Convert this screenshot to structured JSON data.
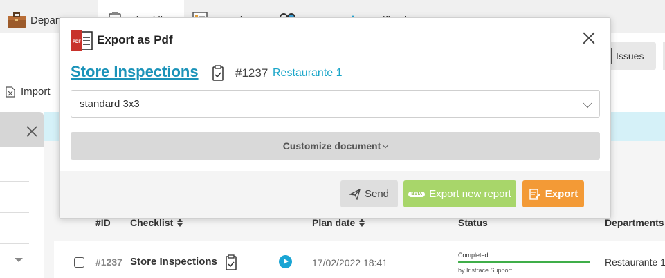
{
  "topnav": {
    "items": [
      {
        "label": "Departments",
        "icon": "briefcase-icon"
      },
      {
        "label": "Checklists",
        "icon": "clipboard-icon"
      },
      {
        "label": "Templates",
        "icon": "template-icon"
      },
      {
        "label": "Users",
        "icon": "users-icon"
      },
      {
        "label": "Notifications",
        "icon": "drop-icon"
      }
    ]
  },
  "background": {
    "issues_label": "Issues",
    "import_label": "Import",
    "table": {
      "headers": {
        "id": "#ID",
        "checklist": "Checklist",
        "plan_date": "Plan date",
        "status": "Status",
        "departments": "Departments"
      },
      "row": {
        "id": "#1237",
        "name": "Store Inspections",
        "plan_date": "17/02/2022 18:41",
        "status": "Completed",
        "progress": 1.0,
        "by": "by Iristrace Support",
        "department": "Restaurante 1"
      }
    }
  },
  "modal": {
    "title": "Export as Pdf",
    "checklist_name": "Store Inspections",
    "checklist_id": "#1237",
    "department_link": "Restaurante 1",
    "template_select_value": "standard 3x3",
    "customize_label": "Customize document",
    "buttons": {
      "send": "Send",
      "beta_badge": "BETA",
      "export_new": "Export new report",
      "export": "Export"
    }
  },
  "colors": {
    "link": "#1b93b9",
    "export_orange": "#f39a36",
    "export_new_green": "#a8d66a",
    "progress_green": "#3fae49",
    "play_blue": "#1aa5d4"
  }
}
